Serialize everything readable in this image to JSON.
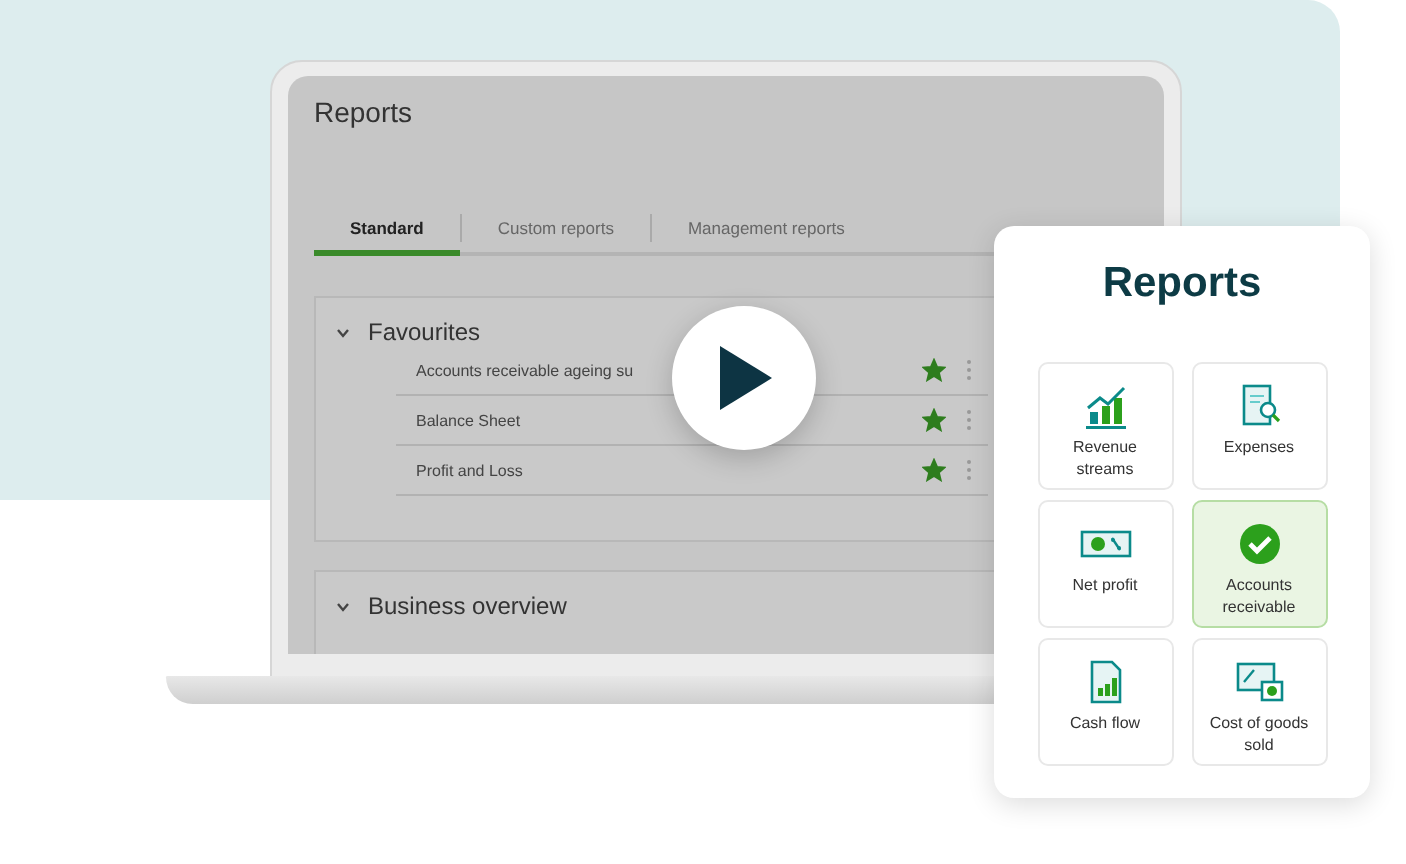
{
  "screen": {
    "title": "Reports",
    "tabs": [
      {
        "label": "Standard",
        "selected": true
      },
      {
        "label": "Custom reports",
        "selected": false
      },
      {
        "label": "Management reports",
        "selected": false
      }
    ],
    "sections": [
      {
        "title": "Favourites",
        "expanded": true,
        "items": [
          {
            "name": "Accounts receivable ageing su",
            "starred": true
          },
          {
            "name": "Balance Sheet",
            "starred": true
          },
          {
            "name": "Profit and Loss",
            "starred": true
          }
        ]
      },
      {
        "title": "Business overview",
        "expanded": true
      }
    ]
  },
  "card": {
    "title": "Reports",
    "tiles": [
      {
        "kind": "revenue",
        "label": "Revenue streams",
        "selected": false
      },
      {
        "kind": "expenses",
        "label": "Expenses",
        "selected": false
      },
      {
        "kind": "net-profit",
        "label": "Net profit",
        "selected": false
      },
      {
        "kind": "receivable",
        "label": "Accounts receivable",
        "selected": true
      },
      {
        "kind": "cash-flow",
        "label": "Cash flow",
        "selected": false
      },
      {
        "kind": "cost",
        "label": "Cost of goods sold",
        "selected": false
      }
    ]
  }
}
